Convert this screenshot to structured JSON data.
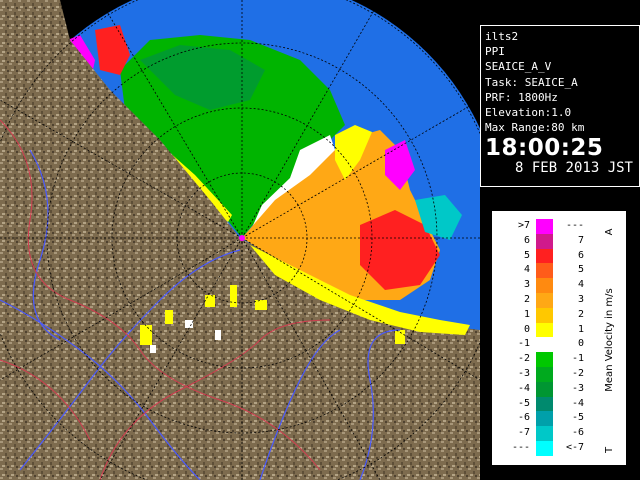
{
  "info": {
    "station": "ilts2",
    "product": "PPI",
    "field": "SEAICE_A_V",
    "task": "Task: SEAICE_A",
    "prf": "PRF: 1800Hz",
    "elevation": "Elevation:1.0",
    "max_range": "Max Range:80 km",
    "time": "18:00:25",
    "date": "8 FEB 2013 JST"
  },
  "legend": {
    "title": "Mean Velocity in m/s",
    "corner_top": "A",
    "corner_bottom": "T",
    "rows": [
      {
        "left": ">7",
        "right": "---",
        "color": "#ff00ff"
      },
      {
        "left": "6",
        "right": "7",
        "color": "#d01a8c"
      },
      {
        "left": "5",
        "right": "6",
        "color": "#ff2020"
      },
      {
        "left": "4",
        "right": "5",
        "color": "#ff5c1a"
      },
      {
        "left": "3",
        "right": "4",
        "color": "#ff8a10"
      },
      {
        "left": "2",
        "right": "3",
        "color": "#ffa815"
      },
      {
        "left": "1",
        "right": "2",
        "color": "#ffc800"
      },
      {
        "left": "0",
        "right": "1",
        "color": "#ffff00"
      },
      {
        "left": "-1",
        "right": "0",
        "color": "#ffffff"
      },
      {
        "left": "-2",
        "right": "-1",
        "color": "#00c800"
      },
      {
        "left": "-3",
        "right": "-2",
        "color": "#00aa1e"
      },
      {
        "left": "-4",
        "right": "-3",
        "color": "#009632"
      },
      {
        "left": "-5",
        "right": "-4",
        "color": "#008a6e"
      },
      {
        "left": "-6",
        "right": "-5",
        "color": "#00a0aa"
      },
      {
        "left": "-7",
        "right": "-6",
        "color": "#00c8c8"
      },
      {
        "left": "---",
        "right": "<-7",
        "color": "#00ffff"
      }
    ]
  },
  "colors": {
    "sea": "#1f6fe6",
    "land": "#7d6b4e",
    "land_light": "#a8977a",
    "river": "#4a5aff",
    "border": "#d23c50",
    "background": "#000000"
  }
}
